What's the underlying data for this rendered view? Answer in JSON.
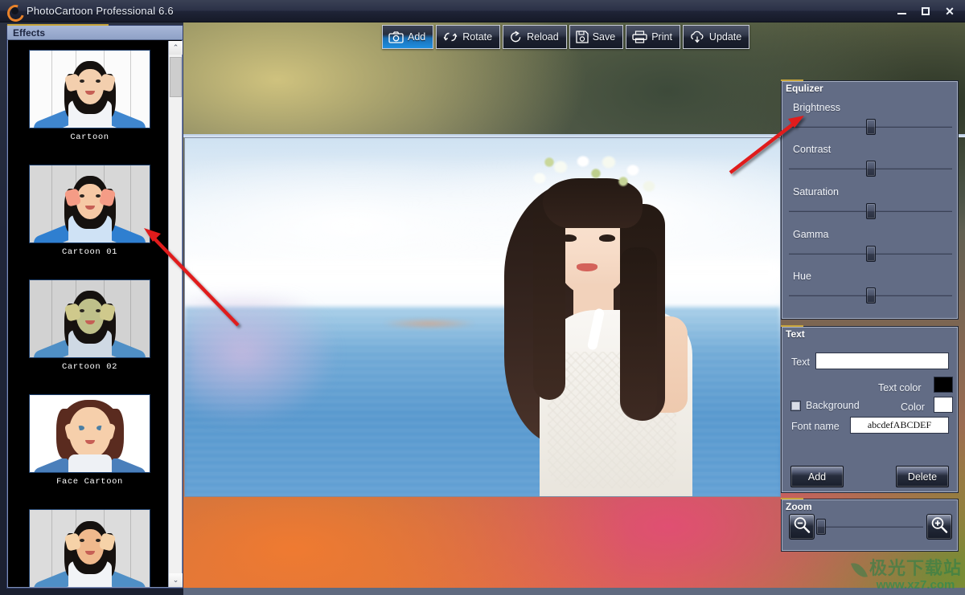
{
  "window": {
    "title": "PhotoCartoon Professional 6.6",
    "app_icon": "photocartoon-logo-icon",
    "minimize_label": "–",
    "maximize_label": "□",
    "close_label": "✕"
  },
  "toolbar": {
    "buttons": [
      {
        "label": "Add",
        "icon": "camera-icon",
        "active": true
      },
      {
        "label": "Rotate",
        "icon": "rotate-icon",
        "active": false
      },
      {
        "label": "Reload",
        "icon": "reload-icon",
        "active": false
      },
      {
        "label": "Save",
        "icon": "floppy-disk-icon",
        "active": false
      },
      {
        "label": "Print",
        "icon": "printer-icon",
        "active": false
      },
      {
        "label": "Update",
        "icon": "cloud-download-icon",
        "active": false
      }
    ]
  },
  "effects": {
    "title": "Effects",
    "items": [
      {
        "label": "Cartoon"
      },
      {
        "label": "Cartoon 01"
      },
      {
        "label": "Cartoon 02"
      },
      {
        "label": "Face Cartoon"
      },
      {
        "label": ""
      }
    ],
    "scroll_up_glyph": "⌃",
    "scroll_down_glyph": "⌄"
  },
  "equalizer": {
    "title": "Equlizer",
    "sliders": [
      {
        "label": "Brightness",
        "value": 50
      },
      {
        "label": "Contrast",
        "value": 50
      },
      {
        "label": "Saturation",
        "value": 50
      },
      {
        "label": "Gamma",
        "value": 50
      },
      {
        "label": "Hue",
        "value": 50
      }
    ]
  },
  "text_panel": {
    "title": "Text",
    "text_label": "Text",
    "text_value": "",
    "text_placeholder": "",
    "text_color_label": "Text color",
    "text_color": "#000000",
    "background_label": "Background",
    "background_checked": false,
    "color_label": "Color",
    "background_color": "#ffffff",
    "font_name_label": "Font name",
    "font_name_value": "abcdefABCDEF",
    "add_label": "Add",
    "delete_label": "Delete"
  },
  "zoom_panel": {
    "title": "Zoom",
    "zoom_out_icon": "magnifier-minus-icon",
    "zoom_in_icon": "magnifier-plus-icon",
    "value": 0
  },
  "annotations": {
    "arrow_1": "red-arrow-pointing-to-cartoon-01-thumbnail",
    "arrow_2": "red-arrow-pointing-to-brightness-slider"
  },
  "watermark": {
    "cn_text": "极光下载站",
    "url_text": "www.xz7.com"
  },
  "colors": {
    "accent_blue": "#1f8fe0",
    "panel_bg": "#626c85",
    "titlebar": "#2b3147",
    "annotation_red": "#e01b1b",
    "caption_gold": "#c8a53a"
  }
}
